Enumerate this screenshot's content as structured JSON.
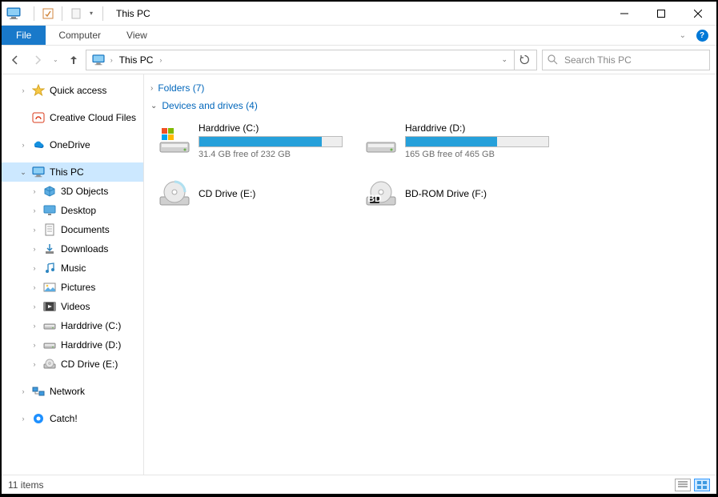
{
  "title": "This PC",
  "ribbon": {
    "file": "File",
    "tabs": [
      "Computer",
      "View"
    ]
  },
  "address": {
    "segments": [
      "This PC"
    ]
  },
  "search": {
    "placeholder": "Search This PC"
  },
  "sidebar": {
    "quick_access": "Quick access",
    "creative_cloud": "Creative Cloud Files",
    "onedrive": "OneDrive",
    "this_pc": "This PC",
    "this_pc_children": [
      "3D Objects",
      "Desktop",
      "Documents",
      "Downloads",
      "Music",
      "Pictures",
      "Videos",
      "Harddrive (C:)",
      "Harddrive (D:)",
      "CD Drive (E:)"
    ],
    "network": "Network",
    "catch": "Catch!"
  },
  "groups": {
    "folders": {
      "label": "Folders",
      "count": 7
    },
    "drives": {
      "label": "Devices and drives",
      "count": 4
    }
  },
  "drives": [
    {
      "name": "Harddrive (C:)",
      "sub": "31.4 GB free of 232 GB",
      "fill": 86,
      "type": "hdd-win"
    },
    {
      "name": "Harddrive (D:)",
      "sub": "165 GB free of 465 GB",
      "fill": 64,
      "type": "hdd"
    },
    {
      "name": "CD Drive (E:)",
      "sub": "",
      "fill": null,
      "type": "cd"
    },
    {
      "name": "BD-ROM Drive (F:)",
      "sub": "",
      "fill": null,
      "type": "bd"
    }
  ],
  "status": {
    "text": "11 items"
  }
}
